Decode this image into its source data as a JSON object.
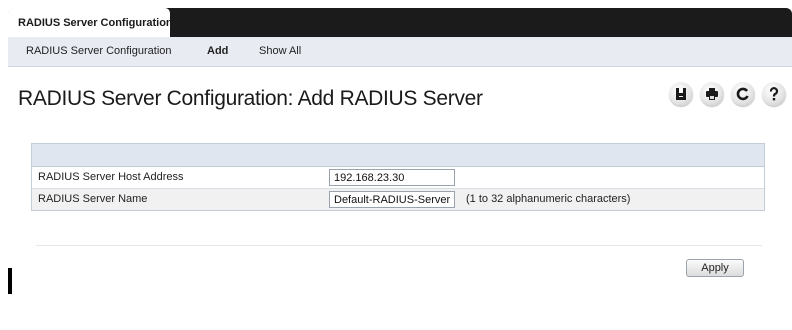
{
  "tabs": [
    {
      "label": "RADIUS Server Configuration",
      "active": true
    }
  ],
  "subnav": {
    "items": [
      {
        "label": "RADIUS Server Configuration",
        "active": false
      },
      {
        "label": "Add",
        "active": true
      },
      {
        "label": "Show All",
        "active": false
      }
    ]
  },
  "page": {
    "title": "RADIUS Server Configuration: Add RADIUS Server"
  },
  "toolbar": {
    "icons": [
      "save-icon",
      "print-icon",
      "refresh-icon",
      "help-icon"
    ]
  },
  "form": {
    "rows": [
      {
        "label": "RADIUS Server Host Address",
        "value": "192.168.23.30",
        "hint": ""
      },
      {
        "label": "RADIUS Server Name",
        "value": "Default-RADIUS-Server",
        "hint": "(1 to 32 alphanumeric characters)"
      }
    ]
  },
  "actions": {
    "apply_label": "Apply"
  },
  "colors": {
    "tabbar": "#1b1b1b",
    "subnav_bg": "#e8ecf2",
    "panel_header": "#dfe6ef"
  }
}
